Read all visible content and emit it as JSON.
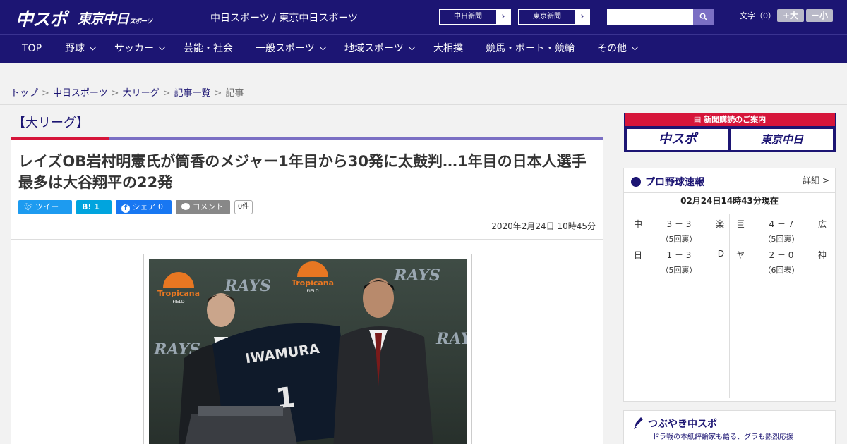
{
  "header": {
    "logo_chuspo": "中スポ",
    "logo_tokyo": "東京中日",
    "logo_tokyo_small": "スポーツ",
    "site_title": "中日スポーツ / 東京中日スポーツ",
    "ext_links": [
      "中日新聞",
      "東京新聞"
    ],
    "search_placeholder": "",
    "font_label": "文字（0）",
    "font_bigger": "+大",
    "font_smaller": "－小"
  },
  "nav": {
    "items": [
      {
        "label": "TOP",
        "has_menu": false
      },
      {
        "label": "野球",
        "has_menu": true
      },
      {
        "label": "サッカー",
        "has_menu": true
      },
      {
        "label": "芸能・社会",
        "has_menu": false
      },
      {
        "label": "一般スポーツ",
        "has_menu": true
      },
      {
        "label": "地域スポーツ",
        "has_menu": true
      },
      {
        "label": "大相撲",
        "has_menu": false
      },
      {
        "label": "競馬・ボート・競輪",
        "has_menu": false
      },
      {
        "label": "その他",
        "has_menu": true
      }
    ]
  },
  "breadcrumb": {
    "items": [
      "トップ",
      "中日スポーツ",
      "大リーグ",
      "記事一覧"
    ],
    "current": "記事"
  },
  "article": {
    "category": "【大リーグ】",
    "headline": "レイズOB岩村明憲氏が筒香のメジャー1年目から30発に太鼓判…1年目の日本人選手最多は大谷翔平の22発",
    "share": {
      "tweet": "ツイート",
      "hatena": "B! 1",
      "facebook": "シェア 0",
      "comment": "コメント",
      "comment_count": "0件"
    },
    "date": "2020年2月24日 10時45分",
    "photo": {
      "jersey_name": "IWAMURA",
      "jersey_number": "1",
      "sponsor": "Tropicana",
      "sponsor_sub": "FIELD",
      "team": "RAYS"
    }
  },
  "sidebar": {
    "promo": {
      "title": "新聞購読のご案内",
      "btn1": "中スポ",
      "btn2": "東京中日"
    },
    "baseball": {
      "title": "プロ野球速報",
      "detail": "詳細 >",
      "time": "02月24日14時43分現在",
      "games": [
        {
          "home": "中",
          "score": "3 － 3",
          "away": "楽",
          "inning": "（5回裏）"
        },
        {
          "home": "日",
          "score": "1 － 3",
          "away": "D",
          "inning": "（5回裏）"
        },
        {
          "home": "巨",
          "score": "4 － 7",
          "away": "広",
          "inning": "（5回裏）"
        },
        {
          "home": "ヤ",
          "score": "2 － 0",
          "away": "神",
          "inning": "（6回表）"
        }
      ]
    },
    "tsubuyaki": {
      "title": "つぶやき中スポ",
      "subtitle": "ドラ戦の本紙評論家も語る、グラも熱烈応援"
    }
  }
}
